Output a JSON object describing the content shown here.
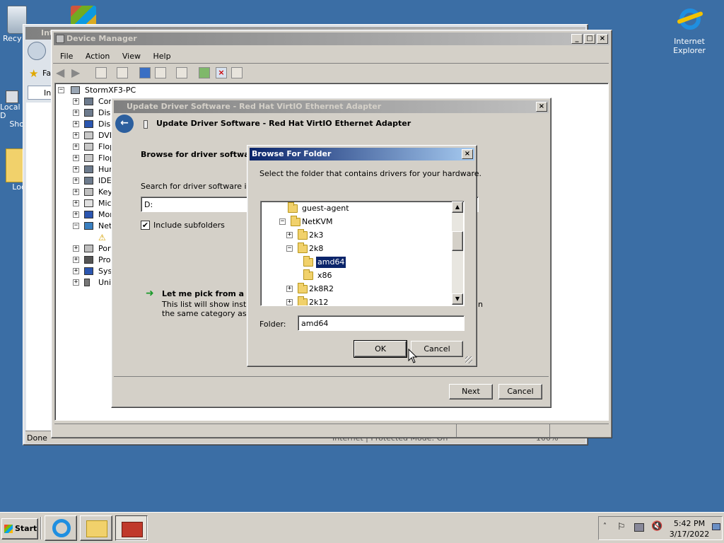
{
  "desktop": {
    "icons": [
      {
        "label": "Recy"
      },
      {
        "label": "Internet Explorer"
      },
      {
        "label": "Local D"
      },
      {
        "label": "Sho"
      },
      {
        "label": "Loc"
      }
    ]
  },
  "ie_window": {
    "title_fragment": "Int",
    "fav_label": "Fa",
    "tab_label": "In",
    "status_left": "Done",
    "status_zone": "Internet | Protected Mode: On",
    "zoom": "100%"
  },
  "device_manager": {
    "title": "Device Manager",
    "menu": [
      "File",
      "Action",
      "View",
      "Help"
    ],
    "tree_root": "StormXF3-PC",
    "tree_items": [
      "Con",
      "Disk",
      "Disp",
      "DVD",
      "Flop",
      "Flop",
      "Hum",
      "IDE",
      "Key",
      "Mice",
      "Mon",
      "Netv",
      "",
      "Port",
      "Proc",
      "Syst",
      "Univ"
    ]
  },
  "update_driver": {
    "title": "Update Driver Software - Red Hat VirtIO Ethernet Adapter",
    "heading": "Update Driver Software - Red Hat VirtIO Ethernet Adapter",
    "browse_heading": "Browse for driver software",
    "search_label": "Search for driver software in",
    "path_value": "D:",
    "include_subfolders": "Include subfolders",
    "pick_link": "Let me pick from a lis",
    "pick_desc_1": "This list will show installed",
    "pick_desc_2": "the same category as the",
    "pick_desc_tail": "in",
    "next_label": "Next",
    "cancel_label": "Cancel"
  },
  "browse_folder": {
    "title": "Browse For Folder",
    "instruction": "Select the folder that contains drivers for your hardware.",
    "tree": [
      {
        "label": "guest-agent",
        "expander": ""
      },
      {
        "label": "NetKVM",
        "expander": "−"
      },
      {
        "label": "2k3",
        "expander": "+"
      },
      {
        "label": "2k8",
        "expander": "−"
      },
      {
        "label": "amd64",
        "expander": "",
        "selected": true
      },
      {
        "label": "x86",
        "expander": ""
      },
      {
        "label": "2k8R2",
        "expander": "+"
      },
      {
        "label": "2k12",
        "expander": "+"
      }
    ],
    "folder_label": "Folder:",
    "folder_value": "amd64",
    "ok_label": "OK",
    "cancel_label": "Cancel"
  },
  "taskbar": {
    "start_label": "Start",
    "time": "5:42 PM",
    "date": "3/17/2022"
  },
  "colors": {
    "desktop": "#3b6ea5",
    "active_title": "#0a246a",
    "selection": "#0a246a"
  }
}
